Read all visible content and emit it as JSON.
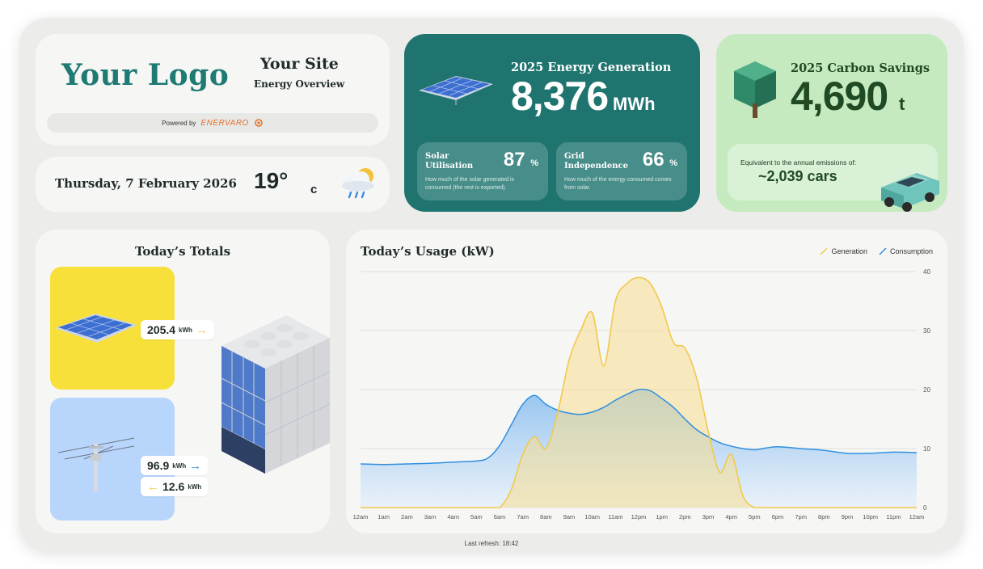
{
  "brand": {
    "logo_text": "Your Logo",
    "site_title": "Your Site",
    "site_subtitle": "Energy Overview",
    "powered_by": "Powered by",
    "powered_brand": "ENERVARO"
  },
  "today": {
    "date": "Thursday, 7 February 2026",
    "temperature": "19°",
    "temperature_unit": "c",
    "weather_icon": "cloud-rain-sun-icon"
  },
  "generation": {
    "title": "2025 Energy Generation",
    "value": "8,376",
    "unit": "MWh",
    "solar_utilisation": {
      "title": "Solar Utilisation",
      "value": "87",
      "unit": "%",
      "description": "How much of the solar generated is consumed (the rest is exported)."
    },
    "grid_independence": {
      "title": "Grid Independence",
      "value": "66",
      "unit": "%",
      "description": "How much of the energy consumed comes from solar."
    }
  },
  "carbon": {
    "title": "2025 Carbon Savings",
    "value": "4,690",
    "unit": "t",
    "equivalent_label": "Equivalent to the annual emissions of:",
    "equivalent_value": "~2,039 cars"
  },
  "totals": {
    "title": "Today’s Totals",
    "solar": {
      "value": "205.4",
      "unit": "kWh",
      "arrow": "→"
    },
    "grid_import": {
      "value": "96.9",
      "unit": "kWh",
      "arrow": "→"
    },
    "grid_export": {
      "value": "12.6",
      "unit": "kWh",
      "arrow": "←"
    }
  },
  "usage": {
    "title": "Today’s Usage (kW)",
    "legend_generation": "Generation",
    "legend_consumption": "Consumption"
  },
  "colors": {
    "generation_line": "#f2c94c",
    "generation_fill": "#f7df8f",
    "consumption_line": "#2f8fe0",
    "consumption_fill": "#7fb8ee",
    "teal": "#1f7470",
    "green": "#c5eac0",
    "yellow": "#f7e03a",
    "blue": "#b8d6fb"
  },
  "chart_data": {
    "type": "area",
    "title": "Today’s Usage (kW)",
    "xlabel": "",
    "ylabel": "",
    "ylim": [
      0,
      40
    ],
    "yticks": [
      0,
      10,
      20,
      30,
      40
    ],
    "categories": [
      "12am",
      "1am",
      "2am",
      "3am",
      "4am",
      "5am",
      "6am",
      "7am",
      "8am",
      "9am",
      "10am",
      "11am",
      "12pm",
      "1pm",
      "2pm",
      "3pm",
      "4pm",
      "5pm",
      "6pm",
      "7pm",
      "8pm",
      "9pm",
      "10pm",
      "11pm",
      "12am"
    ],
    "x": [
      0,
      1,
      2,
      3,
      4,
      5,
      5.5,
      6,
      6.5,
      7,
      7.5,
      8,
      8.5,
      9,
      9.5,
      10,
      10.5,
      11,
      11.5,
      12,
      12.5,
      13,
      13.5,
      14,
      14.5,
      15,
      15.5,
      16,
      16.5,
      17,
      17.5,
      18,
      19,
      20,
      21,
      22,
      23,
      24
    ],
    "series": [
      {
        "name": "Generation",
        "values": [
          0,
          0,
          0,
          0,
          0,
          0,
          0,
          0,
          3,
          9,
          12,
          10,
          16,
          25,
          30,
          33,
          24,
          35,
          38,
          39,
          38,
          34,
          28,
          27,
          22,
          13,
          6,
          9,
          2,
          0,
          0,
          0,
          0,
          0,
          0,
          0,
          0,
          0
        ]
      },
      {
        "name": "Consumption",
        "values": [
          7.4,
          7.3,
          7.4,
          7.5,
          7.7,
          7.9,
          8.4,
          10.5,
          14,
          17.5,
          19,
          17.5,
          16.5,
          16,
          15.8,
          16.2,
          17,
          18.2,
          19.2,
          20,
          19.8,
          18.5,
          17,
          15,
          13.2,
          12,
          11,
          10.4,
          10,
          9.8,
          10.1,
          10.3,
          10,
          9.7,
          9.2,
          9.2,
          9.4,
          9.3
        ]
      }
    ],
    "grid": true,
    "legend": "top-right"
  },
  "footer": {
    "last_refresh": "Last refresh: 18:42"
  }
}
